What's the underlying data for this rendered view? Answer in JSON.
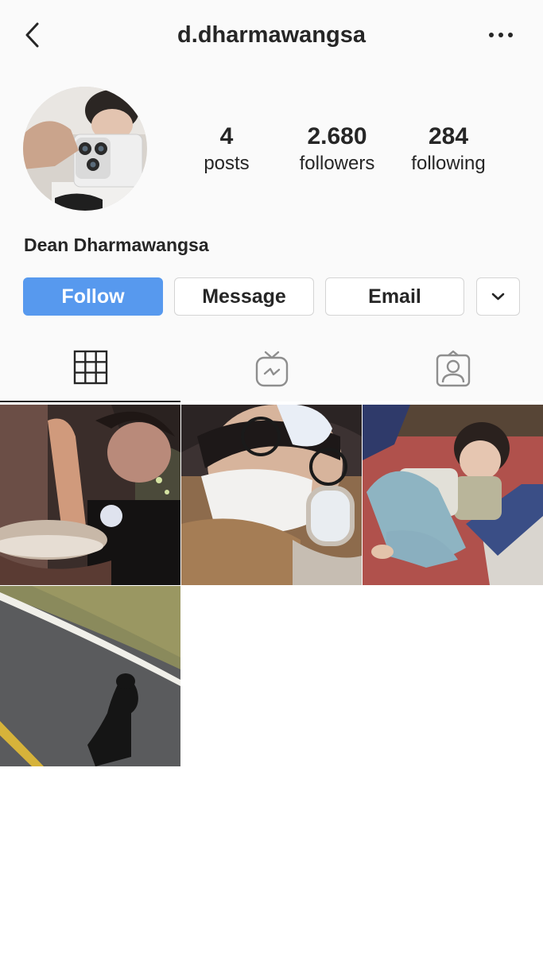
{
  "header": {
    "username": "d.dharmawangsa",
    "back_icon": "chevron-left-icon",
    "more_icon": "more-horizontal-icon"
  },
  "profile": {
    "full_name": "Dean Dharmawangsa",
    "avatar": "profile-photo"
  },
  "stats": {
    "posts": {
      "value": "4",
      "label": "posts"
    },
    "followers": {
      "value": "2.680",
      "label": "followers"
    },
    "following": {
      "value": "284",
      "label": "following"
    }
  },
  "actions": {
    "follow": "Follow",
    "message": "Message",
    "email": "Email",
    "more_icon": "chevron-down-icon"
  },
  "tabs": [
    {
      "name": "grid",
      "icon": "grid-icon",
      "active": true
    },
    {
      "name": "igtv",
      "icon": "igtv-icon",
      "active": false
    },
    {
      "name": "tagged",
      "icon": "tagged-user-icon",
      "active": false
    }
  ],
  "posts": [
    {
      "name": "post-ice-cream"
    },
    {
      "name": "post-airplane-selfie"
    },
    {
      "name": "post-child-photo"
    },
    {
      "name": "post-shadow-road"
    }
  ],
  "colors": {
    "follow_button": "#5799ee",
    "text": "#262626",
    "header_bg": "#fafafa",
    "border": "#d4d4d4"
  }
}
